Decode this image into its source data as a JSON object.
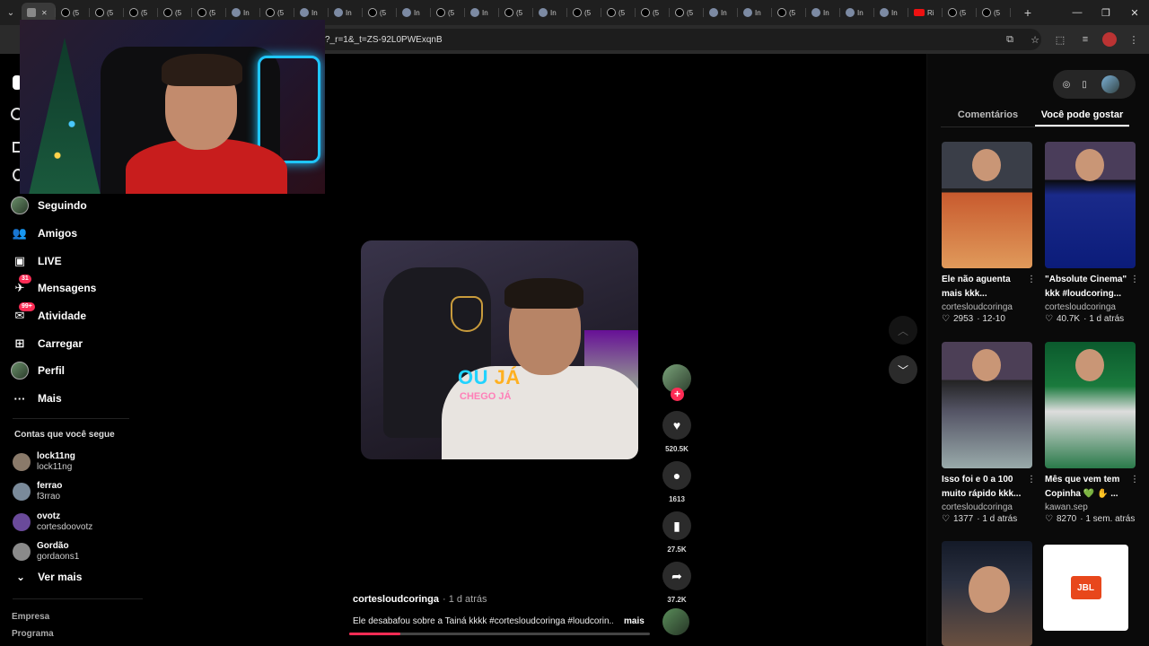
{
  "browser": {
    "tabs": [
      {
        "icon": "sound-icon",
        "label": "",
        "active": true
      },
      {
        "icon": "tiktok-icon",
        "label": "(5"
      },
      {
        "icon": "tiktok-icon",
        "label": "(5"
      },
      {
        "icon": "tiktok-icon",
        "label": "(5"
      },
      {
        "icon": "tiktok-icon",
        "label": "(5"
      },
      {
        "icon": "tiktok-icon",
        "label": "(5"
      },
      {
        "icon": "edge-icon",
        "label": "In"
      },
      {
        "icon": "tiktok-icon",
        "label": "(5"
      },
      {
        "icon": "edge-icon",
        "label": "In"
      },
      {
        "icon": "edge-icon",
        "label": "In"
      },
      {
        "icon": "tiktok-icon",
        "label": "(5"
      },
      {
        "icon": "edge-icon",
        "label": "In"
      },
      {
        "icon": "tiktok-icon",
        "label": "(5"
      },
      {
        "icon": "edge-icon",
        "label": "In"
      },
      {
        "icon": "tiktok-icon",
        "label": "(5"
      },
      {
        "icon": "edge-icon",
        "label": "In"
      },
      {
        "icon": "tiktok-icon",
        "label": "(5"
      },
      {
        "icon": "tiktok-icon",
        "label": "(5"
      },
      {
        "icon": "tiktok-icon",
        "label": "(5"
      },
      {
        "icon": "tiktok-icon",
        "label": "(5"
      },
      {
        "icon": "edge-icon",
        "label": "In"
      },
      {
        "icon": "edge-icon",
        "label": "In"
      },
      {
        "icon": "tiktok-icon",
        "label": "(5"
      },
      {
        "icon": "edge-icon",
        "label": "In"
      },
      {
        "icon": "edge-icon",
        "label": "In"
      },
      {
        "icon": "edge-icon",
        "label": "In"
      },
      {
        "icon": "youtube-icon",
        "label": "Ri"
      },
      {
        "icon": "tiktok-icon",
        "label": "(5"
      },
      {
        "icon": "tiktok-icon",
        "label": "(5"
      }
    ],
    "url": "?_r=1&_t=ZS-92L0PWExqnB"
  },
  "nav": {
    "items": [
      {
        "label": "Seguindo",
        "icon": "avatar-icon",
        "badge": ""
      },
      {
        "label": "Amigos",
        "icon": "friends-icon",
        "badge": ""
      },
      {
        "label": "LIVE",
        "icon": "live-icon",
        "badge": ""
      },
      {
        "label": "Mensagens",
        "icon": "messages-icon",
        "badge": "31"
      },
      {
        "label": "Atividade",
        "icon": "activity-icon",
        "badge": "99+"
      },
      {
        "label": "Carregar",
        "icon": "upload-icon",
        "badge": ""
      },
      {
        "label": "Perfil",
        "icon": "profile-icon",
        "badge": ""
      },
      {
        "label": "Mais",
        "icon": "more-icon",
        "badge": ""
      }
    ],
    "following_title": "Contas que você segue",
    "following": [
      {
        "name": "lock11ng",
        "handle": "lock11ng"
      },
      {
        "name": "ferrao",
        "handle": "f3rrao"
      },
      {
        "name": "ovotz",
        "handle": "cortesdoovotz"
      },
      {
        "name": "Gordão",
        "handle": "gordaons1"
      }
    ],
    "see_more": "Ver mais",
    "footer": [
      "Empresa",
      "Programa"
    ]
  },
  "video": {
    "caption_main": "OU",
    "caption_main_highlight": "JÁ",
    "caption_sub": "CHEGO JÁ",
    "author": "cortesloudcoringa",
    "time": "· 1 d atrás",
    "description": "Ele desabafou sobre a Tainá kkkk #cortesloudcoringa #loudcorin...",
    "more": "mais",
    "progress": 0.17,
    "likes": "520.5K",
    "comments": "1613",
    "saves": "27.5K",
    "shares": "37.2K"
  },
  "right": {
    "tabs": [
      "Comentários",
      "Você pode gostar"
    ],
    "active_tab": 1,
    "cards": [
      {
        "title": "Ele não aguenta mais kkk...",
        "author": "cortesloudcoringa",
        "likes": "2953",
        "date": "· 12-10"
      },
      {
        "title": "\"Absolute Cinema\" kkk #loudcoring...",
        "author": "cortesloudcoringa",
        "likes": "40.7K",
        "date": "· 1 d atrás"
      },
      {
        "title": "Isso foi e 0 a 100 muito rápido kkk...",
        "author": "cortesloudcoringa",
        "likes": "1377",
        "date": "· 1 d atrás"
      },
      {
        "title": "Mês que vem tem Copinha 💚 ✋ ...",
        "author": "kawan.sep",
        "likes": "8270",
        "date": "· 1 sem. atrás"
      }
    ],
    "ad_label": "JBL"
  },
  "colors": {
    "accent": "#fe2c55",
    "background": "#000000",
    "panel": "#0a0a0a"
  }
}
